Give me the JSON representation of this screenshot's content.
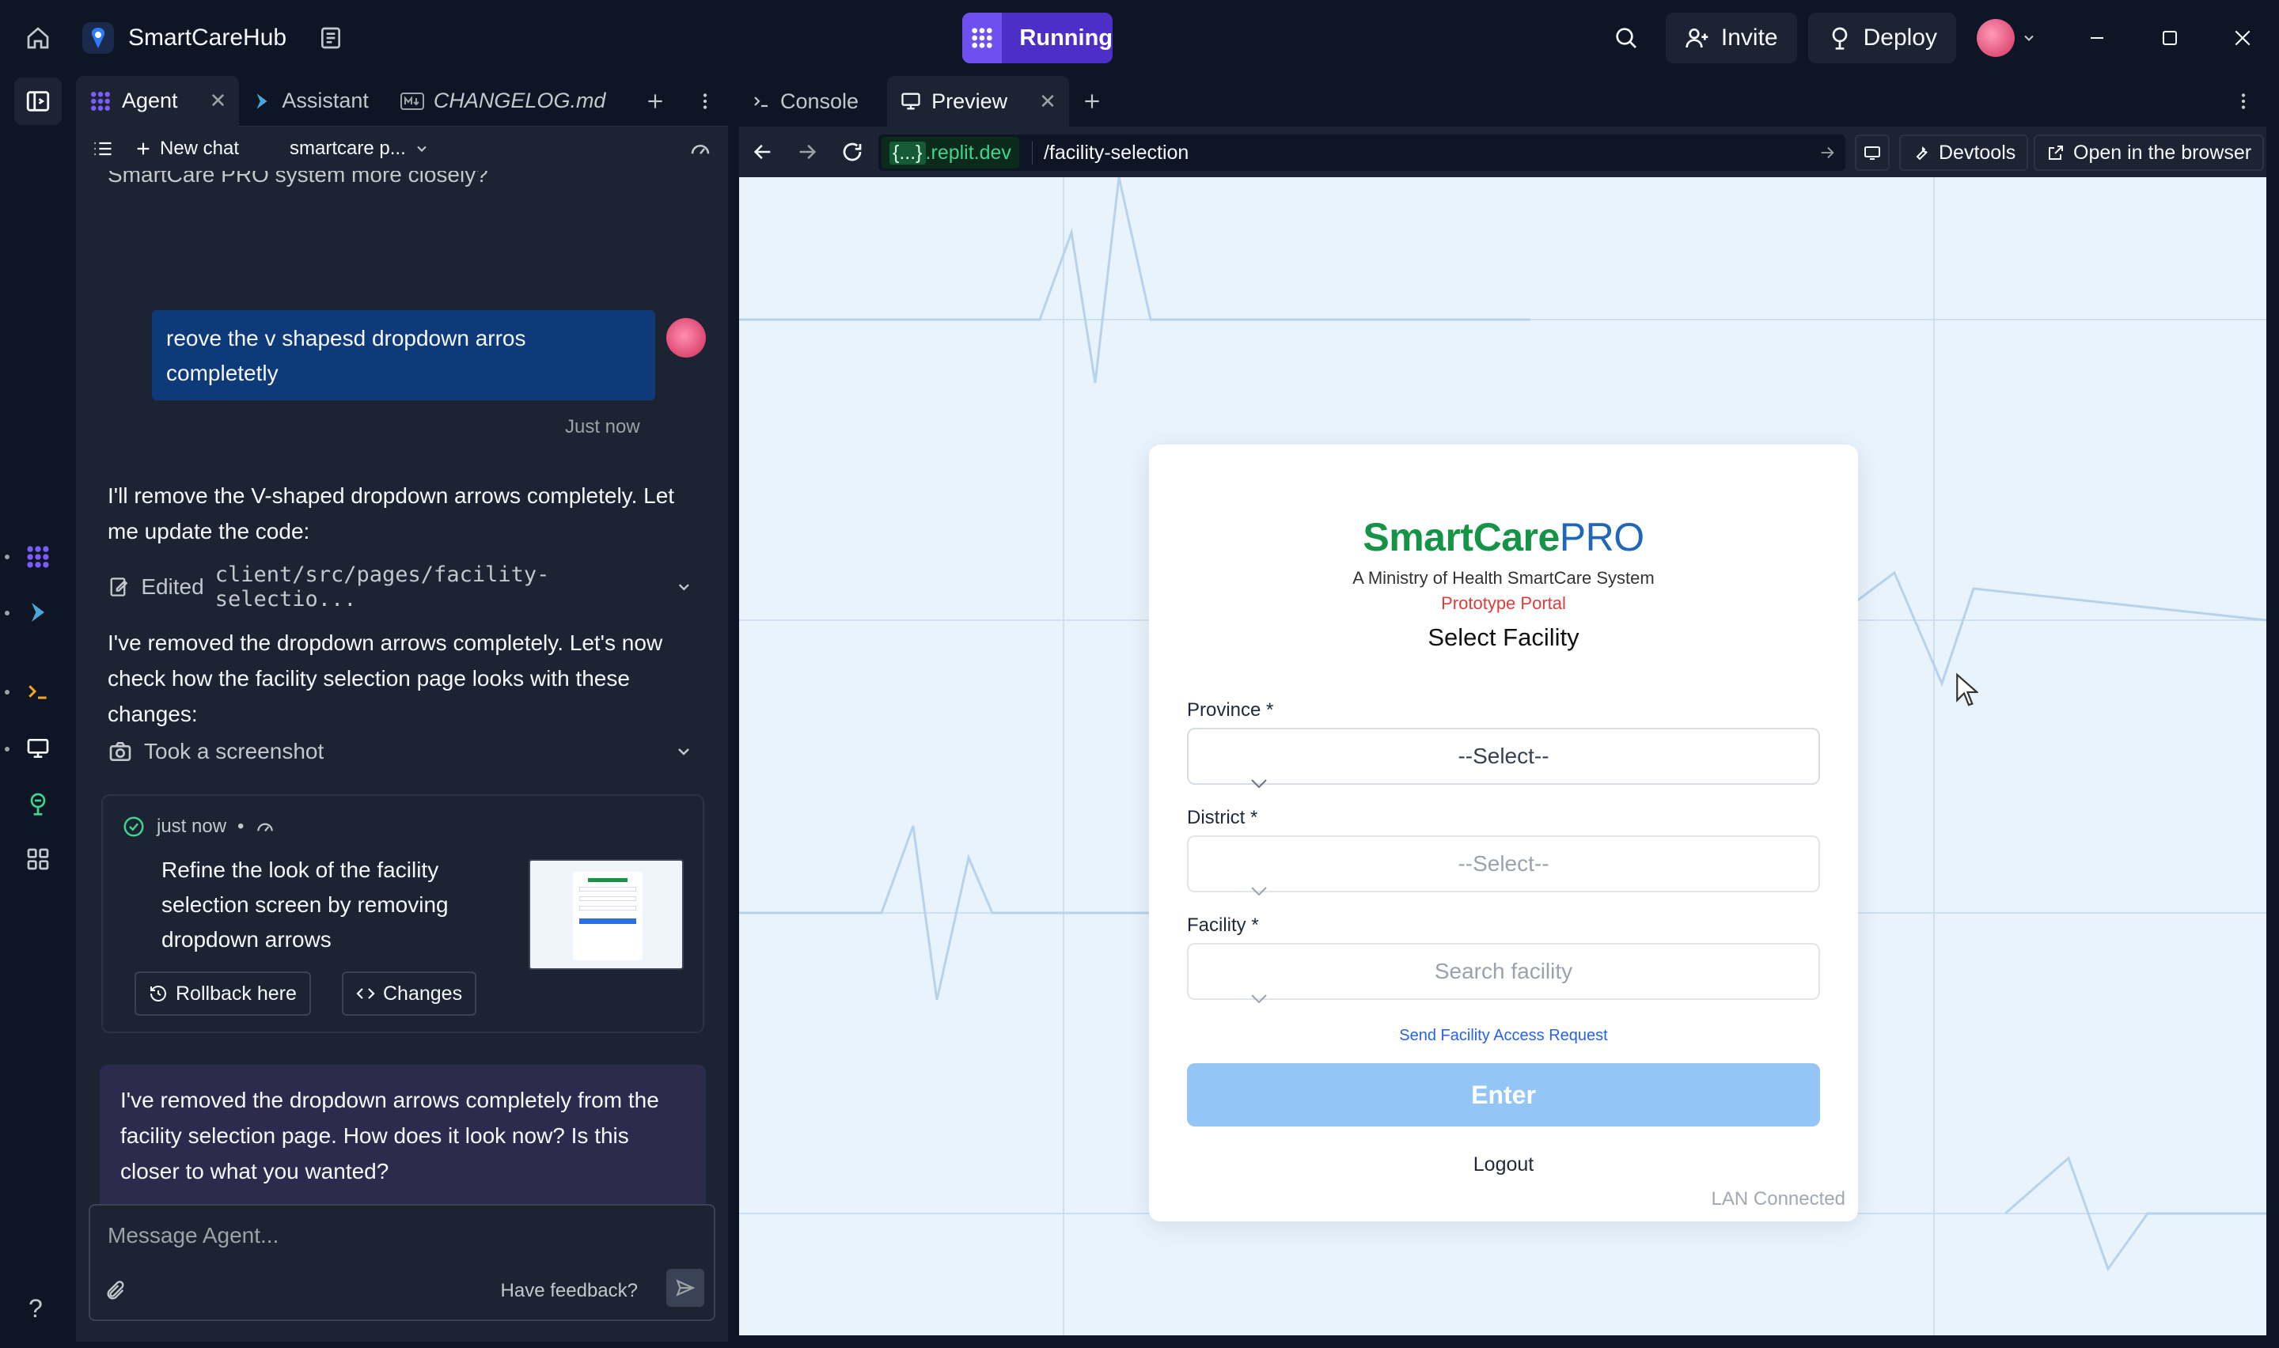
{
  "titlebar": {
    "app_name": "SmartCareHub",
    "run_label": "Running",
    "invite_label": "Invite",
    "deploy_label": "Deploy"
  },
  "chat_tabs": [
    {
      "label": "Agent",
      "icon": "agent-icon"
    },
    {
      "label": "Assistant",
      "icon": "assistant-icon"
    },
    {
      "label": "CHANGELOG.md",
      "icon": "markdown-icon"
    }
  ],
  "chat_toolbar": {
    "new_chat": "New chat",
    "project": "smartcare p..."
  },
  "conversation": {
    "clipped_line": "SmartCare PRO system more closely?",
    "user_message": "reove the v shapesd dropdown arros completetly",
    "user_time": "Just now",
    "agent_msg_1": "I'll remove the V-shaped dropdown arrows completely. Let me update the code:",
    "edited_prefix": "Edited",
    "edited_path": "client/src/pages/facility-selectio...",
    "agent_msg_2": "I've removed the dropdown arrows completely. Let's now check how the facility selection page looks with these changes:",
    "screenshot_label": "Took a screenshot",
    "checkpoint": {
      "time": "just now",
      "description": "Refine the look of the facility selection screen by removing dropdown arrows",
      "rollback_label": "Rollback here",
      "changes_label": "Changes"
    },
    "agent_question": "I've removed the dropdown arrows completely from the facility selection page. How does it look now? Is this closer to what you wanted?"
  },
  "composer": {
    "placeholder": "Message Agent...",
    "feedback": "Have feedback?"
  },
  "right_tabs": [
    {
      "label": "Console"
    },
    {
      "label": "Preview"
    }
  ],
  "address_bar": {
    "domain_badge": "{...}",
    "domain": ".replit.dev",
    "path": "/facility-selection",
    "devtools": "Devtools",
    "open_browser": "Open in the browser"
  },
  "app": {
    "brand_green": "SmartCare",
    "brand_blue": "PRO",
    "subtitle": "A Ministry of Health SmartCare System",
    "portal": "Prototype Portal",
    "heading": "Select Facility",
    "province_label": "Province *",
    "province_value": "--Select--",
    "district_label": "District *",
    "district_value": "--Select--",
    "facility_label": "Facility *",
    "facility_placeholder": "Search facility",
    "access_link": "Send Facility Access Request",
    "enter_label": "Enter",
    "logout_label": "Logout",
    "status": "LAN Connected"
  },
  "colors": {
    "run_accent": "#6f4ff0",
    "brand_green": "#159447",
    "brand_blue": "#2067b8",
    "portal_red": "#e23b3b",
    "enter_btn": "#93c5f5"
  }
}
